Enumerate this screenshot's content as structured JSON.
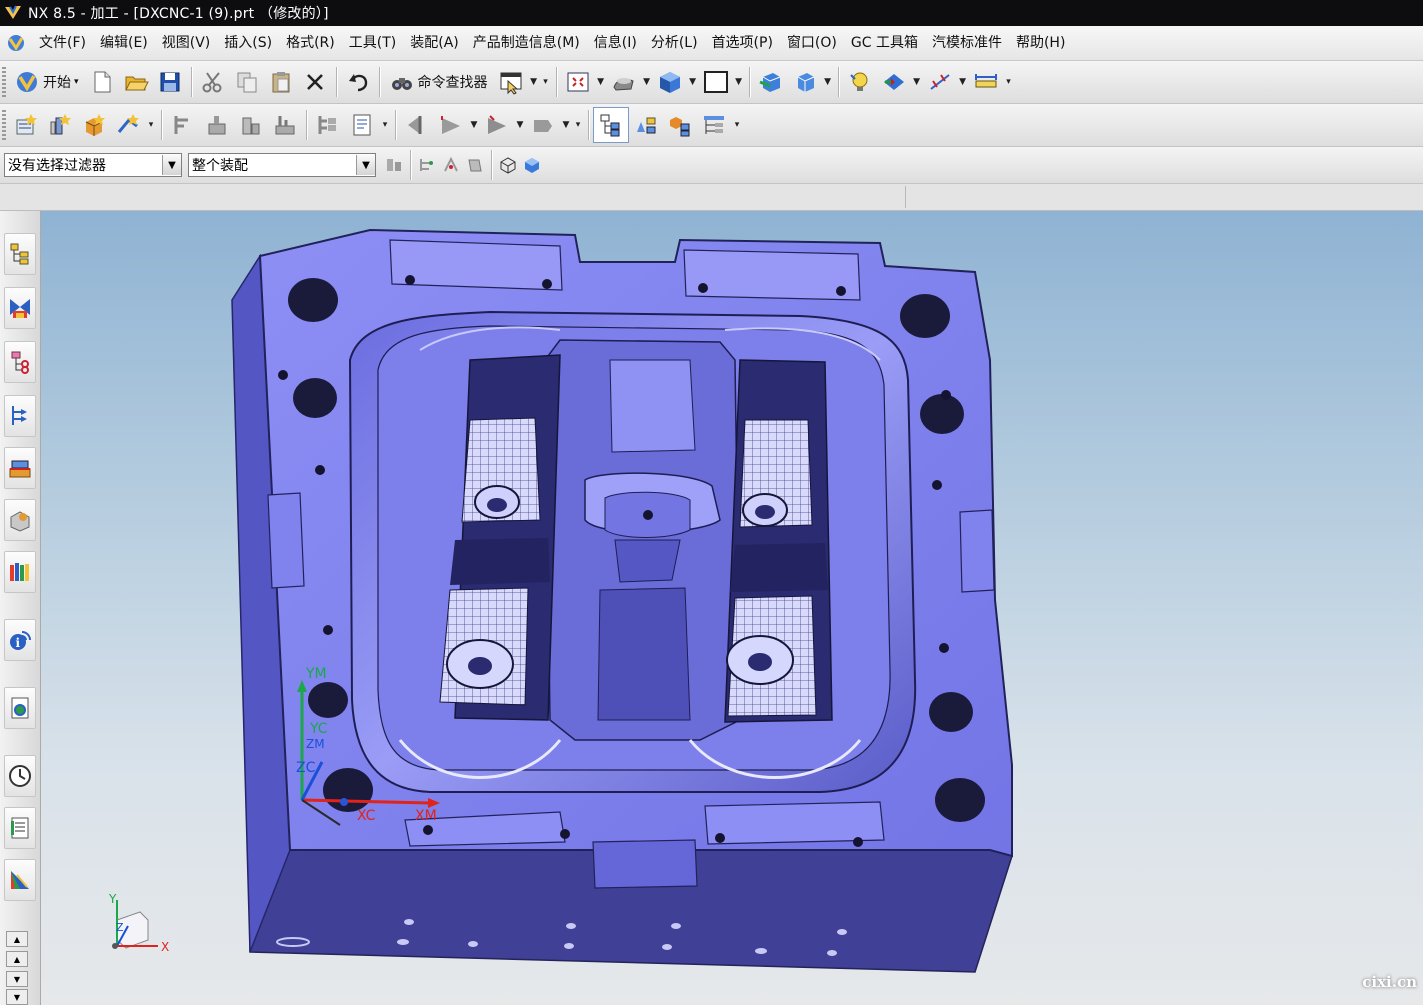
{
  "window": {
    "title": "NX 8.5 - 加工 - [DXCNC-1 (9).prt （修改的）]"
  },
  "menu": [
    "文件(F)",
    "编辑(E)",
    "视图(V)",
    "插入(S)",
    "格式(R)",
    "工具(T)",
    "装配(A)",
    "产品制造信息(M)",
    "信息(I)",
    "分析(L)",
    "首选项(P)",
    "窗口(O)",
    "GC 工具箱",
    "汽模标准件",
    "帮助(H)"
  ],
  "toolbar": {
    "start_label": "开始",
    "command_finder_label": "命令查找器"
  },
  "selection": {
    "filter_value": "没有选择过滤器",
    "scope_value": "整个装配"
  },
  "view": {
    "wcs_labels": {
      "ym": "YM",
      "yc": "YC",
      "zc": "ZC",
      "xc": "XC",
      "xm": "XM",
      "zm": "ZM"
    },
    "triad_labels": {
      "x": "X",
      "y": "Y",
      "z": "Z"
    }
  },
  "watermark": "cixi.cn",
  "colors": {
    "part": "#7b7cf0",
    "part_dark": "#3e3e9a",
    "titlebar": "#0d0d10"
  }
}
